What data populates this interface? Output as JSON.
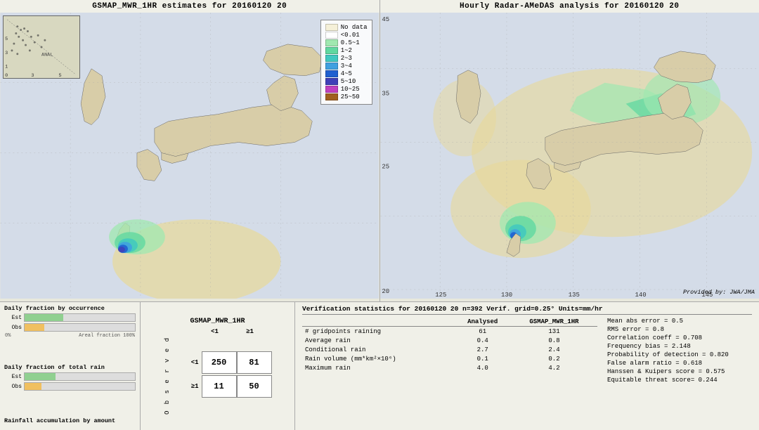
{
  "maps": {
    "left": {
      "title": "GSMAP_MWR_1HR estimates for 20160120 20",
      "inset_label": "ANAL"
    },
    "right": {
      "title": "Hourly Radar-AMeDAS analysis for 20160120 20",
      "provided_by": "Provided by: JWA/JMA"
    }
  },
  "legend": {
    "title": "",
    "items": [
      {
        "label": "No data",
        "color": "#f5f0d8"
      },
      {
        "label": "<0.01",
        "color": "#ffffff"
      },
      {
        "label": "0.5~1",
        "color": "#a0e8b0"
      },
      {
        "label": "1~2",
        "color": "#60d8a0"
      },
      {
        "label": "2~3",
        "color": "#40c8c0"
      },
      {
        "label": "3~4",
        "color": "#40a0e0"
      },
      {
        "label": "4~5",
        "color": "#2060d0"
      },
      {
        "label": "5~10",
        "color": "#4040b8"
      },
      {
        "label": "10~25",
        "color": "#c040c0"
      },
      {
        "label": "25~50",
        "color": "#a06020"
      }
    ]
  },
  "charts": {
    "occurrence_title": "Daily fraction by occurrence",
    "total_rain_title": "Daily fraction of total rain",
    "rainfall_title": "Rainfall accumulation by amount",
    "est_label": "Est",
    "obs_label": "Obs",
    "axis_0": "0%",
    "axis_100": "Areal fraction 100%"
  },
  "contingency": {
    "title": "GSMAP_MWR_1HR",
    "col_header_lt1": "<1",
    "col_header_ge1": "≥1",
    "observed_label": "O\nb\ns\ne\nr\nv\ne\nd",
    "row_lt1": "<1",
    "row_ge1": "≥1",
    "cells": {
      "a": "250",
      "b": "81",
      "c": "11",
      "d": "50"
    }
  },
  "verification": {
    "title": "Verification statistics for 20160120 20  n=392  Verif. grid=0.25°  Units=mm/hr",
    "col_analysed": "Analysed",
    "col_gsmap": "GSMAP_MWR_1HR",
    "divider": "----------",
    "rows": [
      {
        "label": "# gridpoints raining",
        "analysed": "61",
        "gsmap": "131"
      },
      {
        "label": "Average rain",
        "analysed": "0.4",
        "gsmap": "0.8"
      },
      {
        "label": "Conditional rain",
        "analysed": "2.7",
        "gsmap": "2.4"
      },
      {
        "label": "Rain volume (mm*km²×10⁶)",
        "analysed": "0.1",
        "gsmap": "0.2"
      },
      {
        "label": "Maximum rain",
        "analysed": "4.0",
        "gsmap": "4.2"
      }
    ],
    "stats_right": [
      {
        "label": "Mean abs error = 0.5"
      },
      {
        "label": "RMS error = 0.8"
      },
      {
        "label": "Correlation coeff = 0.708"
      },
      {
        "label": "Frequency bias = 2.148"
      },
      {
        "label": "Probability of detection = 0.820"
      },
      {
        "label": "False alarm ratio = 0.618"
      },
      {
        "label": "Hanssen & Kuipers score = 0.575"
      },
      {
        "label": "Equitable threat score= 0.244"
      }
    ]
  }
}
